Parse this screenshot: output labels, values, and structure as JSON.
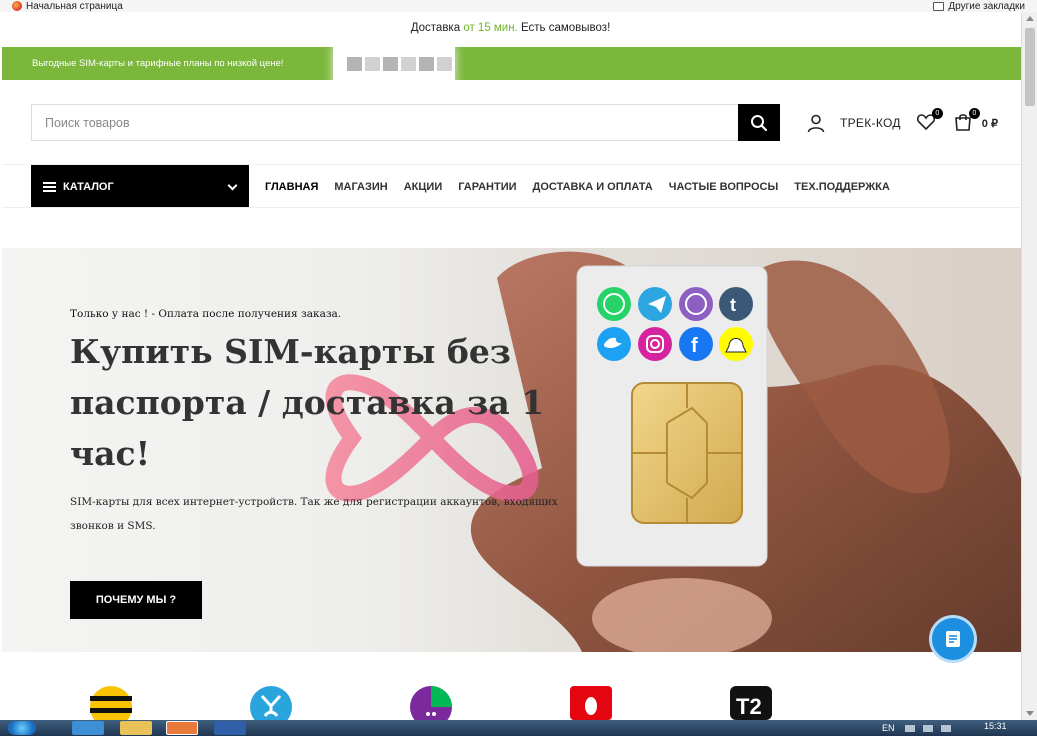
{
  "browser": {
    "bookmark_home": "Начальная страница",
    "bookmark_other": "Другие закладки"
  },
  "topbar": {
    "delivery_prefix": "Доставка ",
    "delivery_accent": "от 15 мин.",
    "delivery_suffix": " Есть самовывоз!"
  },
  "promo": {
    "text": "Выгодные SIM-карты и тарифные планы по низкой цене!",
    "color": "#7ab73a"
  },
  "header": {
    "search_placeholder": "Поиск товаров",
    "track_label": "ТРЕК-КОД",
    "wishlist_count": "0",
    "cart_count": "0",
    "cart_total": "0 ₽",
    "icons": [
      "search-icon",
      "user-icon",
      "heart-icon",
      "shopping-bag-icon"
    ]
  },
  "nav": {
    "catalog_label": "КАТАЛОГ",
    "items": [
      {
        "label": "ГЛАВНАЯ"
      },
      {
        "label": "МАГАЗИН"
      },
      {
        "label": "АКЦИИ"
      },
      {
        "label": "ГАРАНТИИ"
      },
      {
        "label": "ДОСТАВКА И ОПЛАТА"
      },
      {
        "label": "ЧАСТЫЕ ВОПРОСЫ"
      },
      {
        "label": "ТЕХ.ПОДДЕРЖКА"
      }
    ]
  },
  "hero": {
    "eyebrow": "Только у нас ! - Оплата после получения заказа.",
    "title": "Купить SIM-карты без паспорта / доставка за 1 час!",
    "description": "SIM-карты для всех интернет-устройств. Так же для регистрации аккаунтов, входящих звонков и SMS.",
    "button_label": "ПОЧЕМУ МЫ ?",
    "sim_icons": [
      "whatsapp-icon",
      "telegram-icon",
      "viber-icon",
      "tumblr-icon",
      "twitter-icon",
      "instagram-icon",
      "facebook-icon",
      "snapchat-icon"
    ]
  },
  "operators": {
    "logos": [
      "beeline-logo",
      "yota-logo",
      "megafon-logo",
      "mts-logo",
      "tele2-logo"
    ],
    "tele2_text": "T2"
  },
  "taskbar": {
    "lang": "EN",
    "time": "15:31"
  },
  "colors": {
    "accent_green": "#6fb62b",
    "black": "#000000",
    "chat_blue": "#1d8fe0"
  }
}
